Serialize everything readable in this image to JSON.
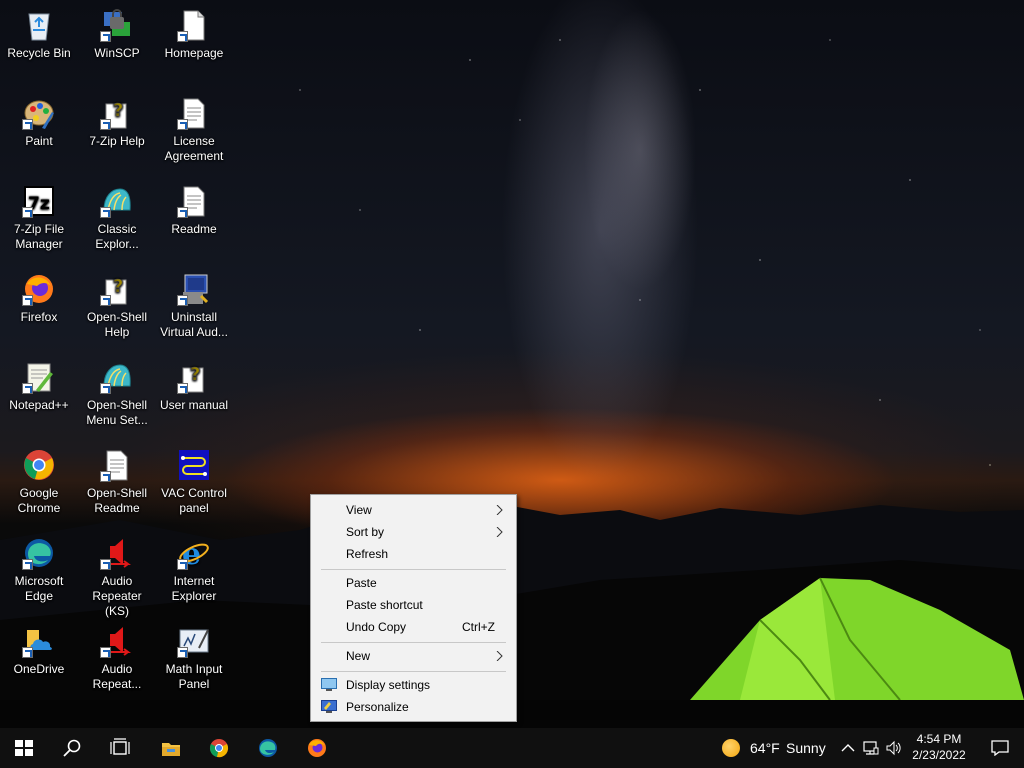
{
  "desktop": {
    "icons": [
      {
        "label": "Recycle Bin",
        "icon": "recycle-bin-icon"
      },
      {
        "label": "WinSCP",
        "icon": "winscp-icon"
      },
      {
        "label": "Homepage",
        "icon": "document-icon"
      },
      {
        "label": "Paint",
        "icon": "paint-icon"
      },
      {
        "label": "7-Zip Help",
        "icon": "help-icon"
      },
      {
        "label": "License Agreement",
        "icon": "text-document-icon"
      },
      {
        "label": "7-Zip File Manager",
        "icon": "7zip-icon"
      },
      {
        "label": "Classic Explor...",
        "icon": "shell-icon"
      },
      {
        "label": "Readme",
        "icon": "text-document-icon"
      },
      {
        "label": "Firefox",
        "icon": "firefox-icon"
      },
      {
        "label": "Open-Shell Help",
        "icon": "help-icon"
      },
      {
        "label": "Uninstall Virtual Aud...",
        "icon": "uninstall-icon"
      },
      {
        "label": "Notepad++",
        "icon": "notepad-plus-icon"
      },
      {
        "label": "Open-Shell Menu Set...",
        "icon": "shell-icon"
      },
      {
        "label": "User manual",
        "icon": "help-icon"
      },
      {
        "label": "Google Chrome",
        "icon": "chrome-icon"
      },
      {
        "label": "Open-Shell Readme",
        "icon": "text-document-icon"
      },
      {
        "label": "VAC Control panel",
        "icon": "vac-icon"
      },
      {
        "label": "Microsoft Edge",
        "icon": "edge-icon"
      },
      {
        "label": "Audio Repeater (KS)",
        "icon": "audio-repeater-icon"
      },
      {
        "label": "Internet Explorer",
        "icon": "ie-icon"
      },
      {
        "label": "OneDrive",
        "icon": "onedrive-icon"
      },
      {
        "label": "Audio Repeat...",
        "icon": "audio-repeater-icon"
      },
      {
        "label": "Math Input Panel",
        "icon": "math-input-icon"
      }
    ]
  },
  "context_menu": {
    "view": "View",
    "sort_by": "Sort by",
    "refresh": "Refresh",
    "paste": "Paste",
    "paste_shortcut": "Paste shortcut",
    "undo_copy": "Undo Copy",
    "undo_copy_shortcut": "Ctrl+Z",
    "new": "New",
    "display_settings": "Display settings",
    "personalize": "Personalize"
  },
  "taskbar": {
    "apps": [
      "start-icon",
      "search-icon",
      "task-view-icon",
      "file-explorer-icon",
      "chrome-icon",
      "edge-icon",
      "firefox-icon"
    ],
    "weather": {
      "temperature": "64°F",
      "condition": "Sunny"
    },
    "clock": {
      "time": "4:54 PM",
      "date": "2/23/2022"
    }
  },
  "colors": {
    "menu_bg": "#f2f2f2",
    "taskbar_bg": "#101010",
    "tent": "#7fd62a"
  }
}
